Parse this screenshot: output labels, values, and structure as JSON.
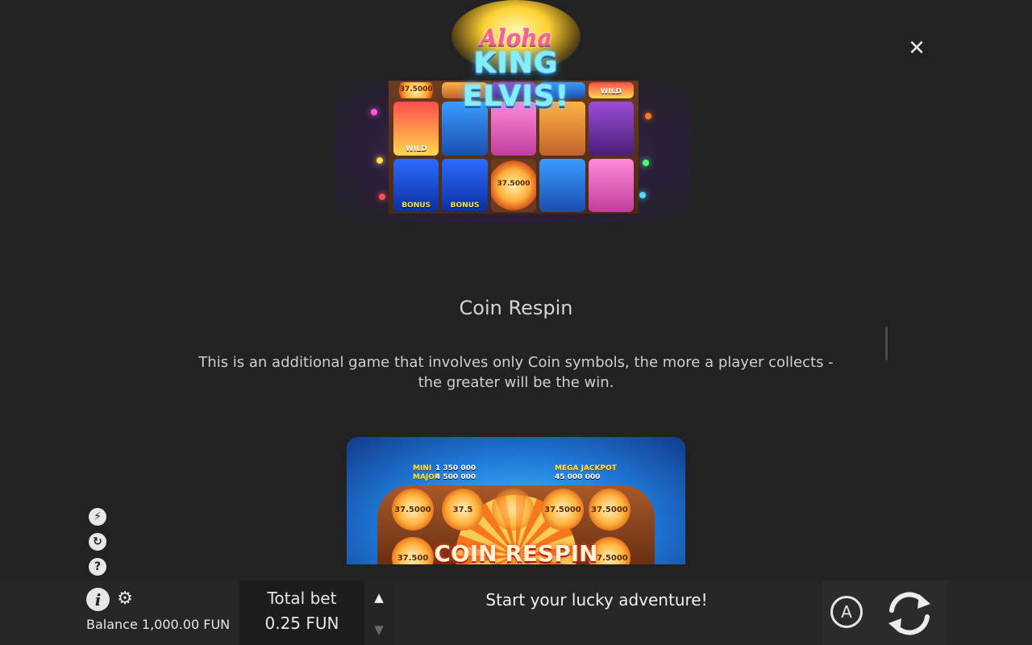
{
  "close_icon": "✕",
  "game_logo": {
    "line1": "Aloha",
    "line2": "KING ELVIS!"
  },
  "reels": {
    "top_row": [
      "37.5000",
      "",
      "",
      "",
      "WILD"
    ],
    "row1": [
      {
        "kind": "frog",
        "label": "WILD"
      },
      {
        "kind": "blue",
        "label": ""
      },
      {
        "kind": "van",
        "label": ""
      },
      {
        "kind": "guitar",
        "label": ""
      },
      {
        "kind": "drum",
        "label": ""
      }
    ],
    "row2": [
      {
        "kind": "tiki",
        "label": "BONUS"
      },
      {
        "kind": "tiki",
        "label": "BONUS"
      },
      {
        "kind": "coin",
        "label": "37.5000"
      },
      {
        "kind": "blue",
        "label": ""
      },
      {
        "kind": "van",
        "label": ""
      }
    ]
  },
  "section": {
    "title": "Coin Respin",
    "body": "This is an additional game that involves only Coin symbols, the more a player collects - the greater will be the win."
  },
  "coin_respin_image": {
    "jackpots": {
      "mini_label": "MINI",
      "mini_value": "1 350 000",
      "major_label": "MAJOR",
      "major_value": "4 500 000",
      "mega_label": "MEGA JACKPOT",
      "mega_value": "45 000 000"
    },
    "coins": [
      "37.5000",
      "37.5",
      "",
      "37.5000",
      "37.5000"
    ],
    "bottom_coins": [
      "37.500",
      "",
      "",
      "",
      "37.5000"
    ],
    "title": "COIN RESPIN"
  },
  "side_icons": {
    "turbo_icon": "⚡",
    "replay_icon": "↻",
    "help_icon": "?"
  },
  "bottom_bar": {
    "info_icon": "i",
    "settings_icon": "⚙",
    "balance": "Balance 1,000.00 FUN",
    "total_bet_label": "Total bet",
    "total_bet_value": "0.25 FUN",
    "bet_up_icon": "▲",
    "bet_down_icon": "▼",
    "message": "Start your lucky adventure!",
    "autoplay_label": "A"
  },
  "colors": {
    "background": "#222222",
    "bottom_bar": "#262626",
    "text": "#d4d4d4"
  }
}
